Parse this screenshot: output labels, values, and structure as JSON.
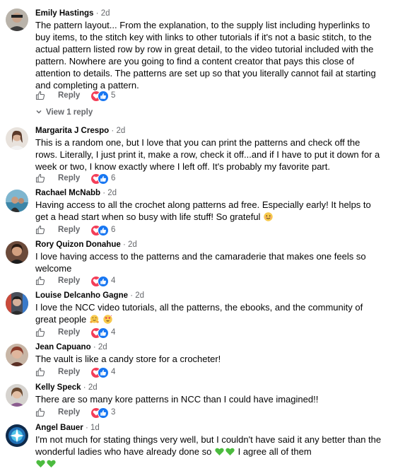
{
  "comments": [
    {
      "name": "Emily Hastings",
      "time": "2d",
      "text": "The pattern layout... From the explanation, to the supply list including hyperlinks to buy items, to the stitch key with links to other tutorials if it's not a basic stitch, to the actual pattern listed row by row in great detail, to the video tutorial included with the pattern. Nowhere are you going to find a content creator that pays this close of attention to details. The patterns are set up so that you literally cannot fail at starting and completing a pattern.",
      "reply": "Reply",
      "reaction_count": "5",
      "reactions": [
        "heart",
        "like"
      ]
    },
    {
      "name": "Margarita J Crespo",
      "time": "2d",
      "text": "This is a random one, but I love that you can print the patterns and check off the rows. Literally, I just print it, make a row, check it off...and if I have to put it down for a week or two, I know exactly where I left off. It's probably my favorite part.",
      "reply": "Reply",
      "reaction_count": "6",
      "reactions": [
        "heart",
        "like"
      ]
    },
    {
      "name": "Rachael McNabb",
      "time": "2d",
      "text": "Having access to all the crochet along patterns ad free. Especially early! It helps to get a head start when so busy with life stuff! So grateful",
      "reply": "Reply",
      "reaction_count": "6",
      "reactions": [
        "heart",
        "like"
      ]
    },
    {
      "name": "Rory Quizon Donahue",
      "time": "2d",
      "text": "I love having access to the patterns and the camaraderie that makes one feels so welcome",
      "reply": "Reply",
      "reaction_count": "4",
      "reactions": [
        "heart",
        "like"
      ]
    },
    {
      "name": "Louise Delcanho Gagne",
      "time": "2d",
      "text": "I love the NCC video tutorials, all the patterns, the ebooks, and the community of great people",
      "reply": "Reply",
      "reaction_count": "4",
      "reactions": [
        "heart",
        "like"
      ]
    },
    {
      "name": "Jean Capuano",
      "time": "2d",
      "text": "The vault is like a candy store for a crocheter!",
      "reply": "Reply",
      "reaction_count": "4",
      "reactions": [
        "heart",
        "like"
      ]
    },
    {
      "name": "Kelly Speck",
      "time": "2d",
      "text": "There are so many kore patterns in NCC than I could have imagined!!",
      "reply": "Reply",
      "reaction_count": "3",
      "reactions": [
        "heart",
        "like"
      ]
    },
    {
      "name": "Angel Bauer",
      "time": "1d",
      "text_a": "I'm not much for stating things very well, but I couldn't have said it any better than the wonderful ladies who have already done so",
      "text_b": "I agree all of them"
    }
  ],
  "view_replies": "View 1 reply",
  "separator": "·",
  "colors": {
    "text": "#050505",
    "secondary": "#65676b",
    "heart": "#f33e58",
    "like": "#1877f2"
  },
  "icons": [
    "like-outline-icon",
    "heart-reaction-icon",
    "like-reaction-icon",
    "chevron-down-icon",
    "smiling-face-emoji",
    "hugging-face-emoji",
    "heart-eyes-emoji",
    "green-heart-emoji"
  ]
}
